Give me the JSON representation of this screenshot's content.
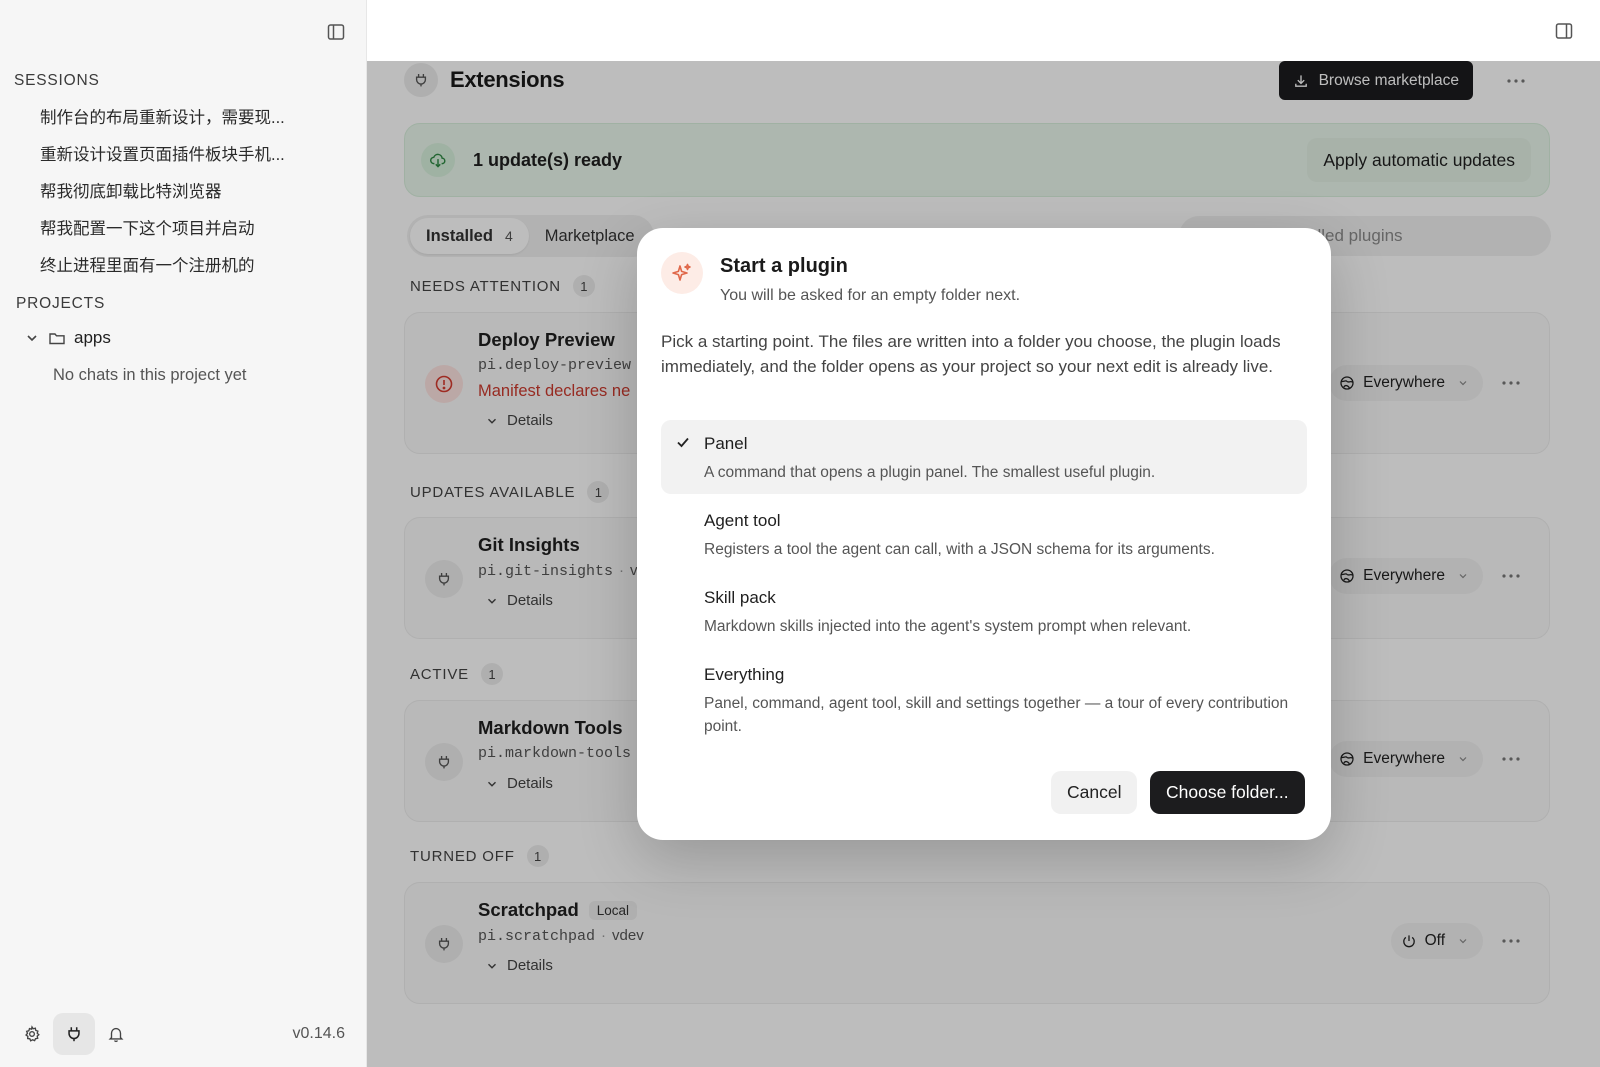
{
  "sidebar": {
    "sessions_heading": "SESSIONS",
    "sessions": [
      "制作台的布局重新设计，需要现...",
      "重新设计设置页面插件板块手机...",
      "帮我彻底卸载比特浏览器",
      "帮我配置一下这个项目并启动",
      "终止进程里面有一个注册机的"
    ],
    "projects_heading": "PROJECTS",
    "project_name": "apps",
    "no_chats": "No chats in this project yet",
    "version": "v0.14.6"
  },
  "extensions": {
    "title": "Extensions",
    "browse_label": "Browse marketplace",
    "update_text": "1 update(s) ready",
    "apply_label": "Apply automatic updates",
    "tabs": [
      {
        "label": "Installed",
        "count": "4"
      },
      {
        "label": "Marketplace",
        "count": ""
      }
    ],
    "search_placeholder": "Search installed plugins",
    "sections": [
      {
        "label": "NEEDS ATTENTION",
        "count": "1"
      },
      {
        "label": "UPDATES AVAILABLE",
        "count": "1"
      },
      {
        "label": "ACTIVE",
        "count": "1"
      },
      {
        "label": "TURNED OFF",
        "count": "1"
      }
    ],
    "details_label": "Details",
    "plugins": [
      {
        "name": "Deploy Preview",
        "id": "pi.deploy-preview",
        "warning": "Manifest declares ne",
        "scope": "Everywhere"
      },
      {
        "name": "Git Insights",
        "id": "pi.git-insights",
        "version": "v",
        "scope": "Everywhere"
      },
      {
        "name": "Markdown Tools",
        "id": "pi.markdown-tools",
        "scope": "Everywhere"
      },
      {
        "name": "Scratchpad",
        "badge": "Local",
        "id": "pi.scratchpad",
        "version": "vdev",
        "scope": "Off"
      }
    ]
  },
  "modal": {
    "title": "Start a plugin",
    "subtitle": "You will be asked for an empty folder next.",
    "description": "Pick a starting point. The files are written into a folder you choose, the plugin loads immediately, and the folder opens as your project so your next edit is already live.",
    "options": [
      {
        "label": "Panel",
        "desc": "A command that opens a plugin panel. The smallest useful plugin.",
        "selected": true
      },
      {
        "label": "Agent tool",
        "desc": "Registers a tool the agent can call, with a JSON schema for its arguments.",
        "selected": false
      },
      {
        "label": "Skill pack",
        "desc": "Markdown skills injected into the agent's system prompt when relevant.",
        "selected": false
      },
      {
        "label": "Everything",
        "desc": "Panel, command, agent tool, skill and settings together — a tour of every contribution point.",
        "selected": false
      }
    ],
    "cancel_label": "Cancel",
    "choose_label": "Choose folder..."
  }
}
